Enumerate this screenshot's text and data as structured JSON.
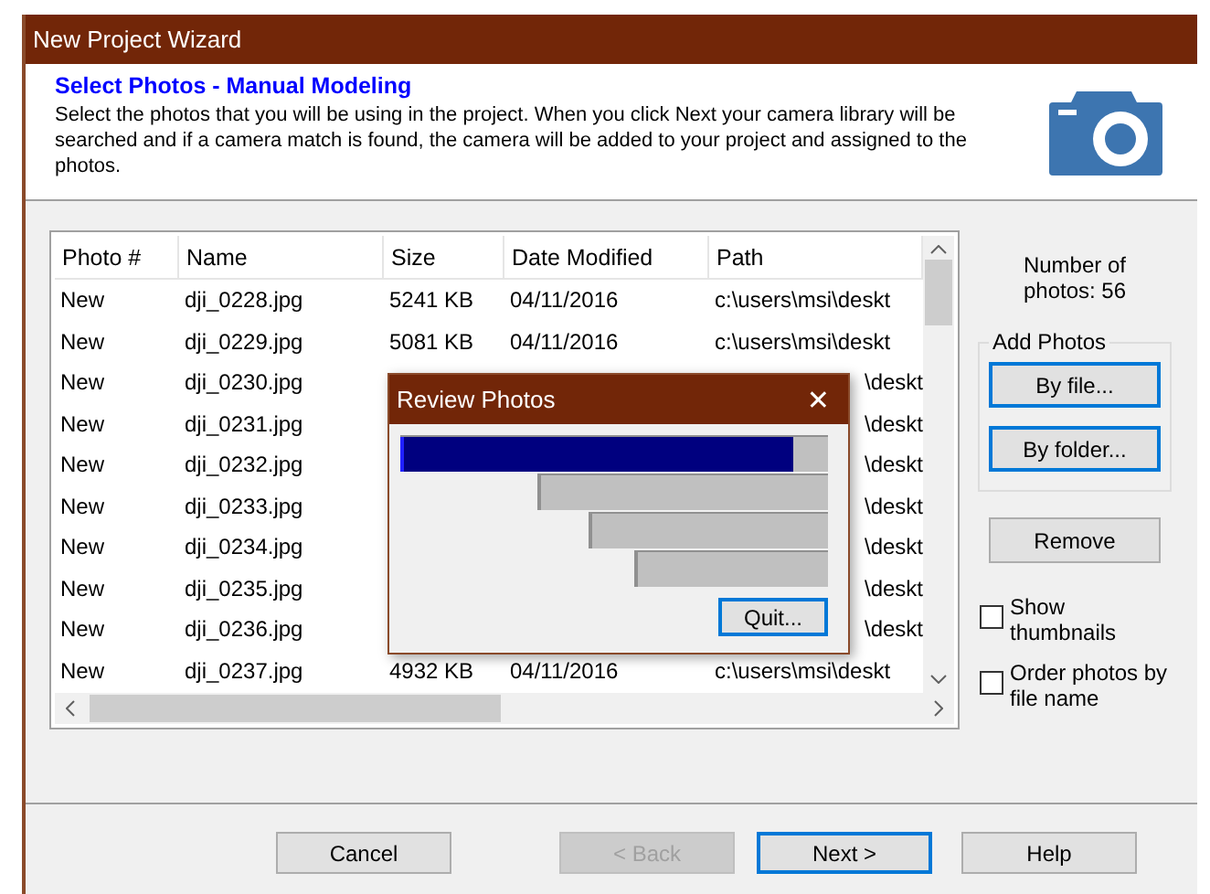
{
  "window": {
    "title": "New Project Wizard"
  },
  "header": {
    "title": "Select Photos - Manual Modeling",
    "description": "Select the photos that you will be using in the project. When you click Next your camera library will be searched and if a camera match is found, the camera will be added to your project and assigned to the photos."
  },
  "table": {
    "columns": [
      "Photo #",
      "Name",
      "Size",
      "Date Modified",
      "Path"
    ],
    "rows": [
      {
        "photo": "New",
        "name": "dji_0228.jpg",
        "size": "5241 KB",
        "date": "04/11/2016",
        "path": "c:\\users\\msi\\deskt"
      },
      {
        "photo": "New",
        "name": "dji_0229.jpg",
        "size": "5081 KB",
        "date": "04/11/2016",
        "path": "c:\\users\\msi\\deskt"
      },
      {
        "photo": "New",
        "name": "dji_0230.jpg",
        "path": "\\deskt"
      },
      {
        "photo": "New",
        "name": "dji_0231.jpg",
        "path": "\\deskt"
      },
      {
        "photo": "New",
        "name": "dji_0232.jpg",
        "path": "\\deskt"
      },
      {
        "photo": "New",
        "name": "dji_0233.jpg",
        "path": "\\deskt"
      },
      {
        "photo": "New",
        "name": "dji_0234.jpg",
        "path": "\\deskt"
      },
      {
        "photo": "New",
        "name": "dji_0235.jpg",
        "path": "\\deskt"
      },
      {
        "photo": "New",
        "name": "dji_0236.jpg",
        "path": "\\deskt"
      },
      {
        "photo": "New",
        "name": "dji_0237.jpg",
        "size": "4932 KB",
        "date": "04/11/2016",
        "path": "c:\\users\\msi\\deskt"
      }
    ]
  },
  "photo_count": [
    "Number of",
    "photos: 56"
  ],
  "add_photos": {
    "label": "Add Photos",
    "buttons": [
      {
        "label": "By file...",
        "focused": true
      },
      {
        "label": "By folder...",
        "focused": true
      }
    ]
  },
  "remove_button": {
    "label": "Remove",
    "focused": false
  },
  "options": [
    {
      "label": "Show thumbnails",
      "checked": false
    },
    {
      "label": "Order photos by file name",
      "checked": false
    }
  ],
  "footer_buttons": [
    {
      "label": "Cancel",
      "disabled": false,
      "focused": false
    },
    {
      "label": "< Back",
      "disabled": true,
      "focused": false
    },
    {
      "label": "Next >",
      "disabled": false,
      "focused": true
    },
    {
      "label": "Help",
      "disabled": false,
      "focused": false
    }
  ],
  "dialog": {
    "title": "Review Photos",
    "close": "✕",
    "progress": {
      "level": 0.92
    },
    "quit_button": {
      "label": "Quit...",
      "focused": true
    }
  }
}
